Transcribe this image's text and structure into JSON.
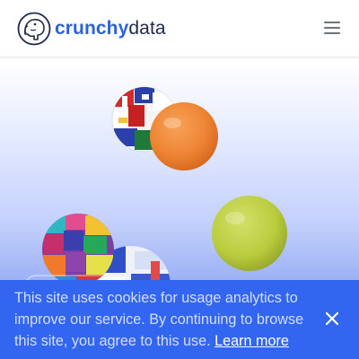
{
  "header": {
    "logo_word_1": "crunchy",
    "logo_word_2": "data",
    "logo_icon": "elephant-icon",
    "menu_icon": "hamburger-menu-icon"
  },
  "cookie_banner": {
    "text": "This site uses cookies for usage analytics to improve our service. By continuing to browse this site, you agree to this use.",
    "link_label": "Learn more",
    "close_icon": "close-icon"
  },
  "colors": {
    "brand_blue": "#2b62d8",
    "brand_dark": "#1e2a4a",
    "banner_blue": "#3366f0"
  }
}
